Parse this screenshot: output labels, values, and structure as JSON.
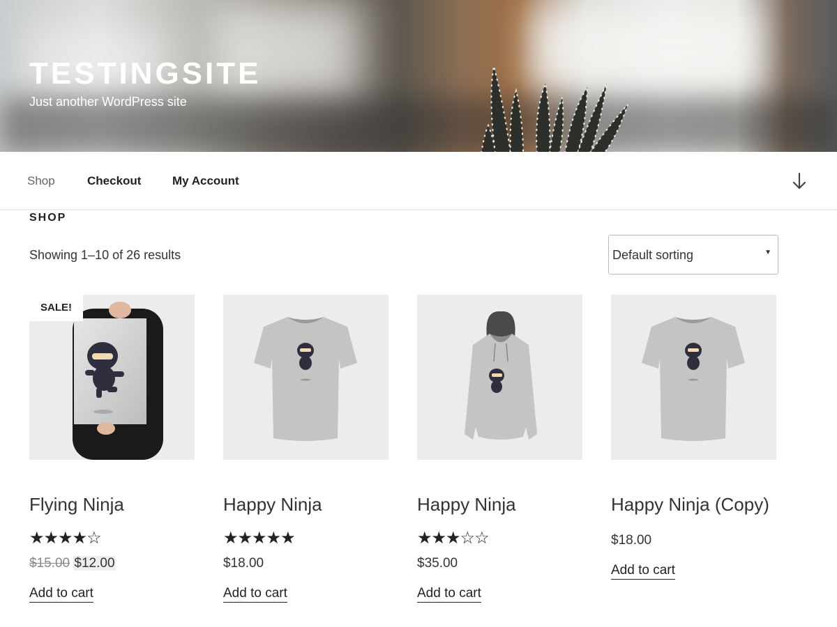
{
  "site": {
    "title": "TESTINGSITE",
    "description": "Just another WordPress site"
  },
  "nav": {
    "items": [
      {
        "label": "Shop",
        "current": true
      },
      {
        "label": "Checkout",
        "current": false
      },
      {
        "label": "My Account",
        "current": false
      }
    ],
    "scroll_icon": "arrow-down-icon"
  },
  "shop": {
    "heading": "SHOP",
    "result_count": "Showing 1–10 of 26 results",
    "sorting": {
      "selected": "Default sorting"
    }
  },
  "products": [
    {
      "title": "Flying Ninja",
      "sale_badge": "SALE!",
      "rating": 4,
      "stars": "★★★★☆",
      "old_price": "$15.00",
      "price": "$12.00",
      "button": "Add to cart",
      "image": "ninja-poster"
    },
    {
      "title": "Happy Ninja",
      "rating": 5,
      "stars": "★★★★★",
      "price": "$18.00",
      "button": "Add to cart",
      "image": "ninja-tshirt"
    },
    {
      "title": "Happy Ninja",
      "rating": 3,
      "stars": "★★★☆☆",
      "price": "$35.00",
      "button": "Add to cart",
      "image": "ninja-hoodie"
    },
    {
      "title": "Happy Ninja (Copy)",
      "price": "$18.00",
      "button": "Add to cart",
      "image": "ninja-tshirt"
    }
  ]
}
